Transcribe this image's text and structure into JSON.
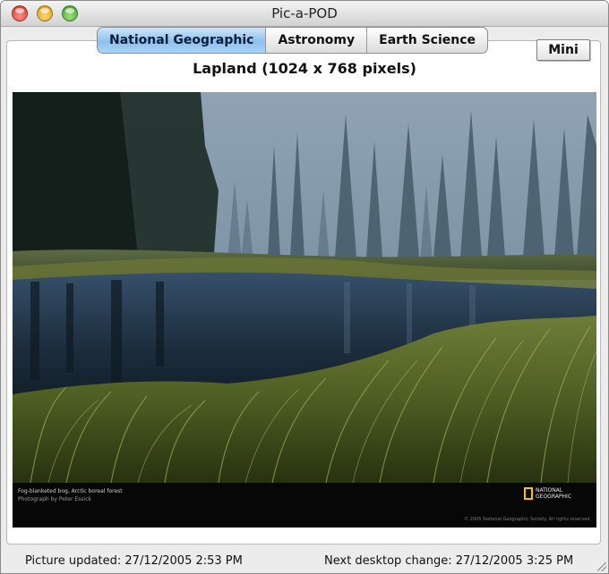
{
  "window": {
    "title": "Pic-a-POD"
  },
  "tabs": [
    {
      "label": "National Geographic",
      "active": true
    },
    {
      "label": "Astronomy",
      "active": false
    },
    {
      "label": "Earth Science",
      "active": false
    }
  ],
  "mini_button": {
    "label": "Mini"
  },
  "picture": {
    "title": "Lapland (1024 x 768 pixels)",
    "caption_line1": "Fog-blanketed bog, Arctic boreal forest",
    "caption_line2": "Photograph by Peter Essick",
    "logo_text": "NATIONAL GEOGRAPHIC",
    "copyright": "© 2005 National Geographic Society. All rights reserved."
  },
  "status": {
    "picture_updated": "Picture updated: 27/12/2005 2:53 PM",
    "next_change": "Next desktop change: 27/12/2005 3:25 PM"
  },
  "colors": {
    "active_tab": "#8fc0ee",
    "logo_yellow": "#f5c400"
  }
}
